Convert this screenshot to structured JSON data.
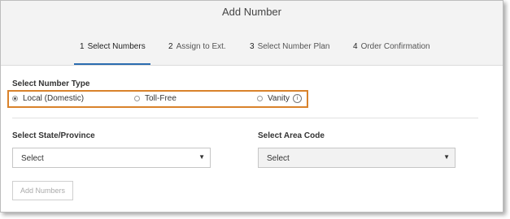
{
  "dialog": {
    "title": "Add Number"
  },
  "steps": [
    {
      "num": "1",
      "label": "Select Numbers",
      "active": true
    },
    {
      "num": "2",
      "label": "Assign to Ext.",
      "active": false
    },
    {
      "num": "3",
      "label": "Select Number Plan",
      "active": false
    },
    {
      "num": "4",
      "label": "Order Confirmation",
      "active": false
    }
  ],
  "number_type": {
    "label": "Select Number Type",
    "options": [
      {
        "label": "Local (Domestic)",
        "selected": true
      },
      {
        "label": "Toll-Free",
        "selected": false
      },
      {
        "label": "Vanity",
        "selected": false,
        "icon": "info-icon"
      }
    ],
    "highlight_color": "#d9822b"
  },
  "state": {
    "label": "Select State/Province",
    "value": "Select"
  },
  "area_code": {
    "label": "Select Area Code",
    "value": "Select"
  },
  "add_button": {
    "label": "Add Numbers",
    "enabled": false
  },
  "colors": {
    "active_step_underline": "#2b6cb0",
    "header_bg": "#f3f3f3"
  }
}
